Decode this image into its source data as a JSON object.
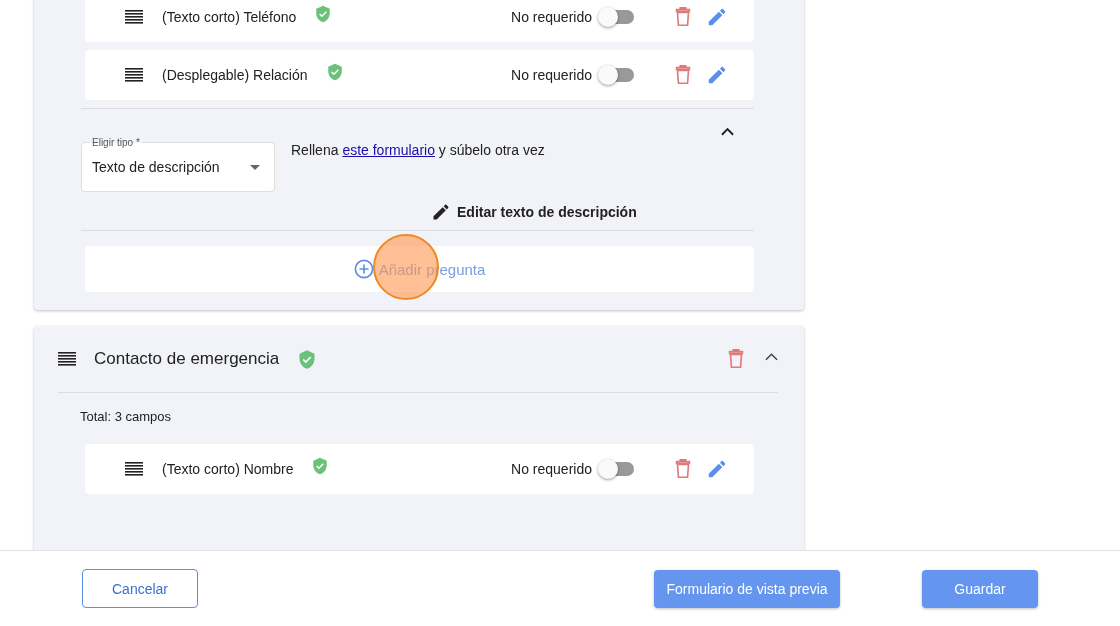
{
  "section_1": {
    "fields": [
      {
        "label": "(Texto corto) Teléfono",
        "valid": true,
        "required_label": "No requerido",
        "on": false
      },
      {
        "label": "(Desplegable) Relación",
        "valid": true,
        "required_label": "No requerido",
        "on": false
      }
    ],
    "description_block": {
      "expanded": true,
      "type_select": {
        "label": "Eligir tipo *",
        "value": "Texto de descripción"
      },
      "text_before": "Rellena",
      "link": "este formulario",
      "text_after": "y súbelo otra vez",
      "edit_button": "Editar texto de descripción"
    },
    "add_question": "Añadir pregunta"
  },
  "section_2": {
    "title": "Contacto de emergencia",
    "valid": true,
    "expanded": true,
    "total": "Total: 3 campos",
    "fields": [
      {
        "label": "(Texto corto) Nombre",
        "valid": true,
        "required_label": "No requerido",
        "on": false
      }
    ]
  },
  "footer": {
    "cancel": "Cancelar",
    "preview": "Formulario de vista previa",
    "save": "Guardar"
  }
}
